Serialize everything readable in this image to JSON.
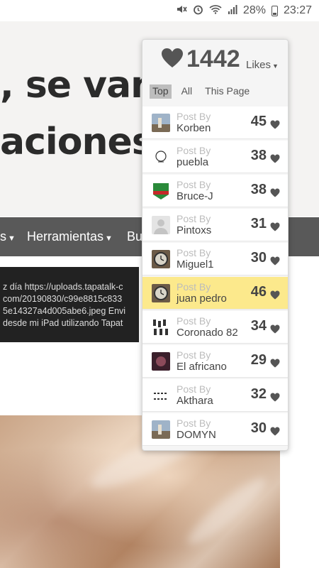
{
  "status_bar": {
    "battery": "28%",
    "time": "23:27"
  },
  "article": {
    "headline_line1": ", se van",
    "headline_line2": "aciones"
  },
  "nav": {
    "items": [
      {
        "label": "s"
      },
      {
        "label": "Herramientas"
      },
      {
        "label": "Bu"
      }
    ]
  },
  "tooltip": {
    "lines": [
      "z día https://uploads.tapatalk-c",
      "com/20190830/c99e8815c833",
      "5e14327a4d005abe6.jpeg Envi",
      " desde mi iPad utilizando Tapat"
    ]
  },
  "likes_panel": {
    "total": "1442",
    "likes_label": "Likes",
    "tabs": [
      {
        "label": "Top",
        "active": true
      },
      {
        "label": "All",
        "active": false
      },
      {
        "label": "This Page",
        "active": false
      }
    ],
    "post_by_label": "Post By",
    "rows": [
      {
        "name": "Korben",
        "count": "45",
        "highlight": false,
        "avatar": "photo-avatar"
      },
      {
        "name": "puebla",
        "count": "38",
        "highlight": false,
        "avatar": "sketch-avatar"
      },
      {
        "name": "Bruce-J",
        "count": "38",
        "highlight": false,
        "avatar": "badge-avatar"
      },
      {
        "name": "Pintoxs",
        "count": "31",
        "highlight": false,
        "avatar": "default-avatar"
      },
      {
        "name": "Miguel1",
        "count": "30",
        "highlight": false,
        "avatar": "watch-avatar"
      },
      {
        "name": "juan pedro",
        "count": "46",
        "highlight": true,
        "avatar": "watch-avatar"
      },
      {
        "name": "Coronado 82",
        "count": "34",
        "highlight": false,
        "avatar": "pattern-avatar"
      },
      {
        "name": "El africano",
        "count": "29",
        "highlight": false,
        "avatar": "dark-avatar"
      },
      {
        "name": "Akthara",
        "count": "32",
        "highlight": false,
        "avatar": "text-avatar"
      },
      {
        "name": "DOMYN",
        "count": "30",
        "highlight": false,
        "avatar": "photo-avatar"
      }
    ]
  },
  "colors": {
    "highlight_row": "#fce98c",
    "nav_bg": "#595959",
    "heart": "#555555"
  }
}
